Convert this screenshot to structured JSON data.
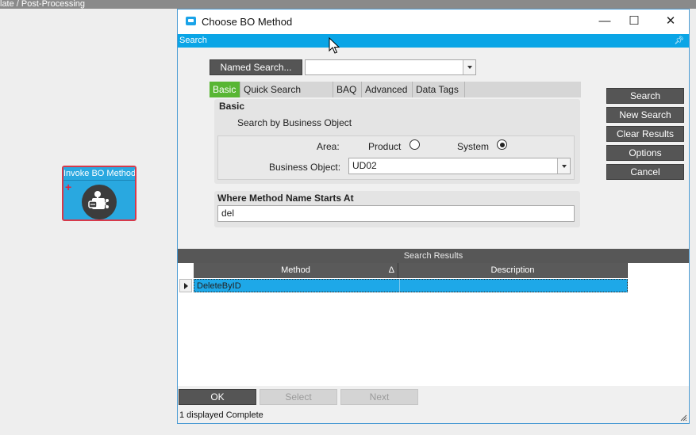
{
  "background": {
    "header_text": "late / Post-Processing",
    "node": {
      "title": "Invoke BO Method",
      "plus": "+"
    }
  },
  "dialog": {
    "title": "Choose BO Method",
    "window_controls": {
      "minimize": "—",
      "maximize": "☐",
      "close": "✕"
    },
    "search_band": "Search",
    "named_search_label": "Named Search...",
    "named_search_value": "",
    "tabs": [
      "Basic",
      "Quick Search",
      "BAQ",
      "Advanced",
      "Data Tags"
    ],
    "basic": {
      "heading": "Basic",
      "subheading": "Search by Business Object",
      "area_label": "Area:",
      "area_options": [
        "Product",
        "System"
      ],
      "area_selected": "System",
      "bo_label": "Business Object:",
      "bo_value": "UD02"
    },
    "where": {
      "heading": "Where Method Name Starts At",
      "value": "del"
    },
    "side_buttons": [
      "Search",
      "New Search",
      "Clear Results",
      "Options",
      "Cancel"
    ],
    "results": {
      "header": "Search Results",
      "columns": [
        "Method",
        "Description"
      ],
      "sort_glyph": "Δ",
      "rows": [
        {
          "method": "DeleteByID",
          "description": ""
        }
      ]
    },
    "bottom_buttons": {
      "ok": "OK",
      "select": "Select",
      "next": "Next"
    },
    "status": "1 displayed Complete"
  },
  "colors": {
    "accent": "#0aa5e6",
    "tab_active": "#58b633",
    "row_selected": "#1ea8e8",
    "node_border": "#d6394a"
  }
}
